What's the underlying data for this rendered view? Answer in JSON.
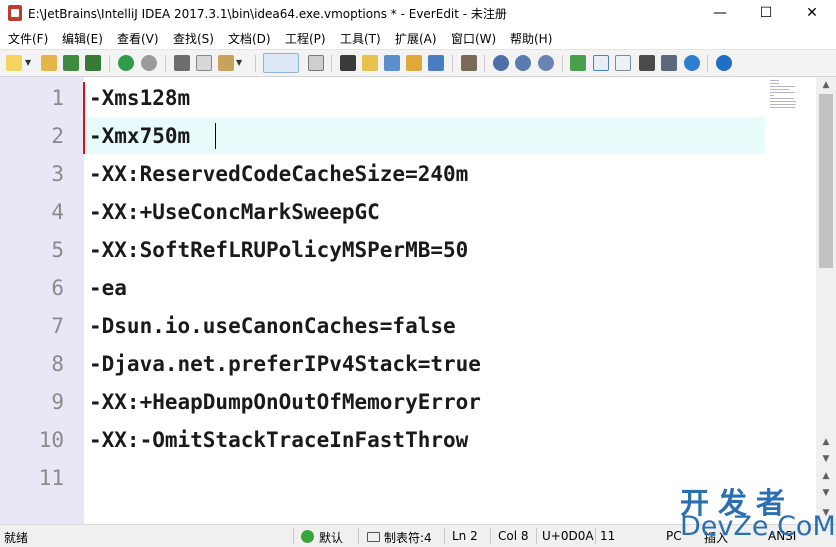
{
  "window": {
    "title": "E:\\JetBrains\\IntelliJ IDEA 2017.3.1\\bin\\idea64.exe.vmoptions * - EverEdit - 未注册",
    "minimize": "—",
    "maximize": "☐",
    "close": "✕"
  },
  "menu": [
    "文件(F)",
    "编辑(E)",
    "查看(V)",
    "查找(S)",
    "文档(D)",
    "工程(P)",
    "工具(T)",
    "扩展(A)",
    "窗口(W)",
    "帮助(H)"
  ],
  "editor": {
    "line_numbers": [
      "1",
      "2",
      "3",
      "4",
      "5",
      "6",
      "7",
      "8",
      "9",
      "10",
      "11"
    ],
    "lines": [
      "-Xms128m",
      "-Xmx750m",
      "-XX:ReservedCodeCacheSize=240m",
      "-XX:+UseConcMarkSweepGC",
      "-XX:SoftRefLRUPolicyMSPerMB=50",
      "-ea",
      "-Dsun.io.useCanonCaches=false",
      "-Djava.net.preferIPv4Stack=true",
      "-XX:+HeapDumpOnOutOfMemoryError",
      "-XX:-OmitStackTraceInFastThrow",
      ""
    ],
    "current_line": 2
  },
  "status": {
    "ready": "就绪",
    "encoding_mode": "默认",
    "tab": "制表符:4",
    "ln": "Ln 2",
    "col": "Col 8",
    "char": "U+0D0A",
    "size": "11",
    "eol": "PC",
    "insert": "插入",
    "charset": "ANSI"
  },
  "watermark": {
    "cn": "开发者",
    "en": "DevZe.CoM"
  },
  "colors": {
    "gutter": "#e7e7f6",
    "current_line": "#e8fbfb",
    "modified_marker": "#dd1111",
    "watermark": "#2a6fb0"
  }
}
